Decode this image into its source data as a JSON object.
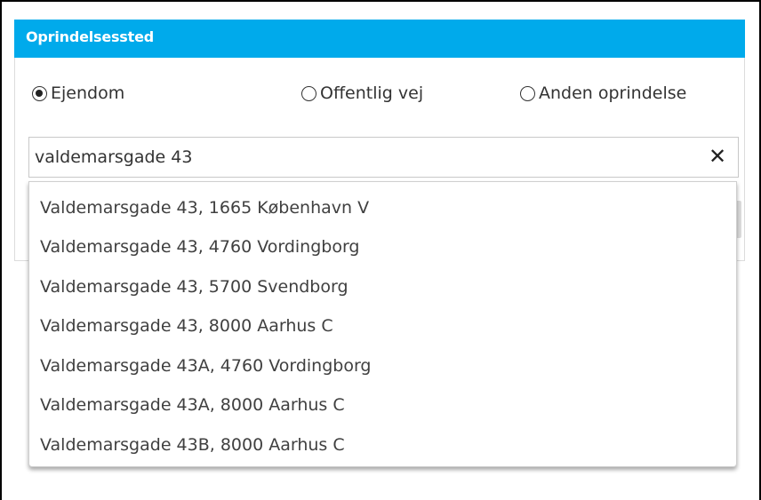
{
  "panel": {
    "title": "Oprindelsessted",
    "header_color": "#00aaeb"
  },
  "origin_options": [
    {
      "label": "Ejendom",
      "checked": true
    },
    {
      "label": "Offentlig vej",
      "checked": false
    },
    {
      "label": "Anden oprindelse",
      "checked": false
    }
  ],
  "search": {
    "value": "valdemarsgade 43",
    "clear_icon": "close-icon"
  },
  "suggestions": [
    "Valdemarsgade 43, 1665 København V",
    "Valdemarsgade 43, 4760 Vordingborg",
    "Valdemarsgade 43, 5700 Svendborg",
    "Valdemarsgade 43, 8000 Aarhus C",
    "Valdemarsgade 43A, 4760 Vordingborg",
    "Valdemarsgade 43A, 8000 Aarhus C",
    "Valdemarsgade 43B, 8000 Aarhus C"
  ]
}
